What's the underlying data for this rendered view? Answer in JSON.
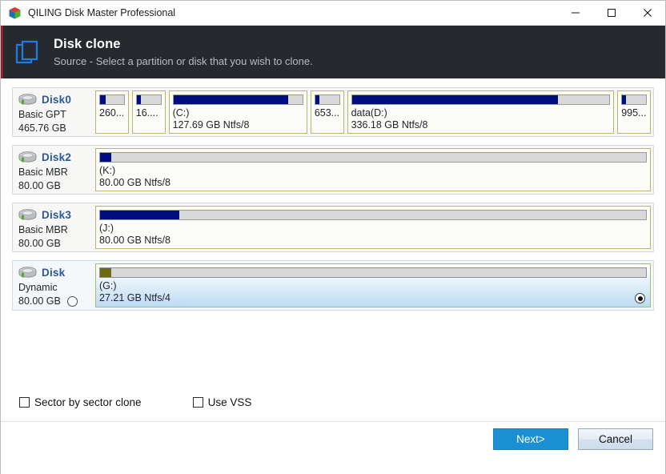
{
  "window": {
    "title": "QILING Disk Master Professional",
    "icon": "cube-icon",
    "controls": {
      "minimize": "minimize-icon",
      "maximize": "maximize-icon",
      "close": "close-icon"
    }
  },
  "header": {
    "icon": "clone-icon",
    "title": "Disk clone",
    "subtitle": "Source - Select a partition or disk that you wish to clone."
  },
  "disks": [
    {
      "name": "Disk0",
      "type": "Basic GPT",
      "size": "465.76 GB",
      "selected": false,
      "has_disk_radio": false,
      "partitions": [
        {
          "label": "",
          "size": "260...",
          "used_pct": 22,
          "flex": 4.4,
          "selected": false,
          "radio": false
        },
        {
          "label": "",
          "size": "16....",
          "used_pct": 17,
          "flex": 4.4,
          "selected": false,
          "radio": false
        },
        {
          "label": "(C:)",
          "size": "127.69 GB Ntfs/8",
          "used_pct": 89,
          "flex": 22.6,
          "selected": false,
          "radio": false
        },
        {
          "label": "",
          "size": "653...",
          "used_pct": 19,
          "flex": 4.4,
          "selected": false,
          "radio": false
        },
        {
          "label": "data(D:)",
          "size": "336.18 GB Ntfs/8",
          "used_pct": 80,
          "flex": 44.8,
          "selected": false,
          "radio": false
        },
        {
          "label": "",
          "size": "995...",
          "used_pct": 17,
          "flex": 4.4,
          "selected": false,
          "radio": false
        }
      ]
    },
    {
      "name": "Disk2",
      "type": "Basic MBR",
      "size": "80.00 GB",
      "selected": false,
      "has_disk_radio": false,
      "partitions": [
        {
          "label": "(K:)",
          "size": "80.00 GB Ntfs/8",
          "used_pct": 2,
          "flex": 100,
          "selected": false,
          "radio": false
        }
      ]
    },
    {
      "name": "Disk3",
      "type": "Basic MBR",
      "size": "80.00 GB",
      "selected": false,
      "has_disk_radio": false,
      "partitions": [
        {
          "label": "(J:)",
          "size": "80.00 GB Ntfs/8",
          "used_pct": 14.5,
          "flex": 100,
          "selected": false,
          "radio": false
        }
      ]
    },
    {
      "name": "Disk",
      "type": "Dynamic",
      "size": "80.00 GB",
      "selected": true,
      "has_disk_radio": true,
      "disk_radio_on": false,
      "partitions": [
        {
          "label": "(G:)",
          "size": "27.21 GB Ntfs/4",
          "used_pct": 2,
          "flex": 40.5,
          "selected": true,
          "radio": true,
          "radio_on": true
        }
      ]
    }
  ],
  "options": [
    {
      "label": "Sector by sector clone",
      "checked": false
    },
    {
      "label": "Use VSS",
      "checked": false
    }
  ],
  "footer": {
    "next_label": "Next>",
    "cancel_label": "Cancel"
  },
  "colors": {
    "header_bg": "#262a2e",
    "accent_blue": "#1a8fd1",
    "disk_name": "#2b5797",
    "usage_fill": "#000e82",
    "selected_usage_fill": "#6d6a16",
    "partition_border": "#b9b76b",
    "accent_stripe": "#8a2230"
  }
}
